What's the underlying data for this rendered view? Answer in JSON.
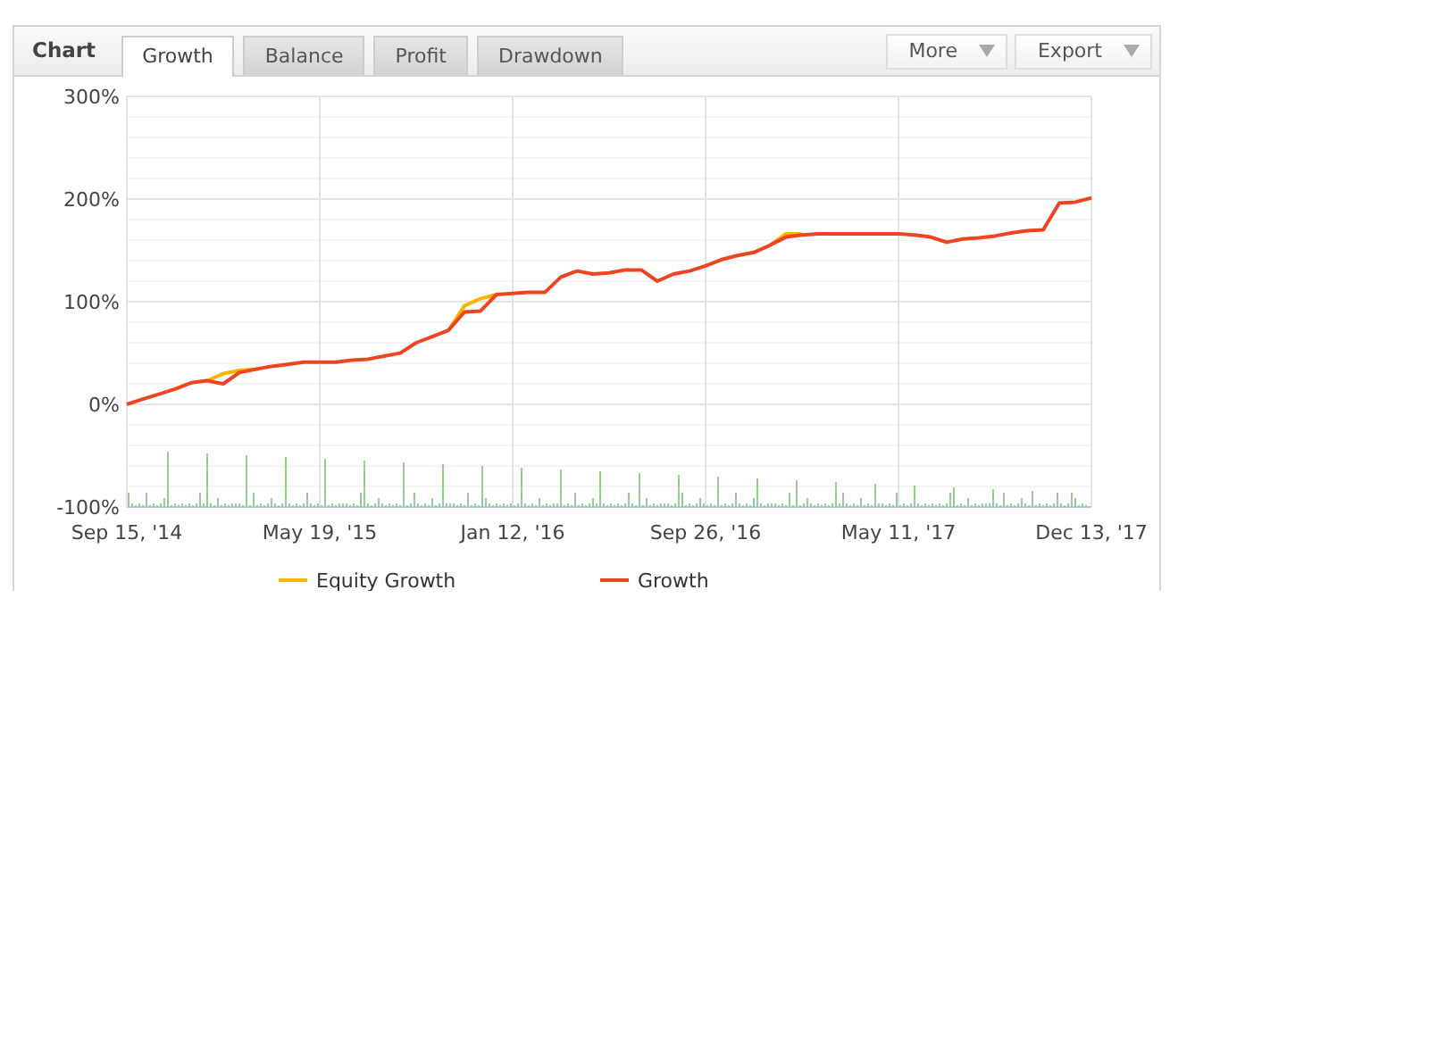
{
  "panel": {
    "title": "Chart",
    "tabs": [
      {
        "label": "Growth",
        "selected": true
      },
      {
        "label": "Balance",
        "selected": false
      },
      {
        "label": "Profit",
        "selected": false
      },
      {
        "label": "Drawdown",
        "selected": false
      }
    ],
    "buttons": [
      "More",
      "Export"
    ],
    "chart_data": {
      "type": "line",
      "categories": [
        "Sep 15, '14",
        null,
        null,
        null,
        null,
        null,
        null,
        null,
        null,
        null,
        null,
        null,
        "May 19, '15",
        null,
        null,
        null,
        null,
        null,
        null,
        null,
        null,
        null,
        null,
        null,
        "Jan 12, '16",
        null,
        null,
        null,
        null,
        null,
        null,
        null,
        null,
        null,
        null,
        null,
        "Sep 26, '16",
        null,
        null,
        null,
        null,
        null,
        null,
        null,
        null,
        null,
        null,
        null,
        "May 11, '17",
        null,
        null,
        null,
        null,
        null,
        null,
        null,
        null,
        null,
        null,
        null,
        "Dec 13, '17"
      ],
      "ylim": [
        -100,
        300
      ],
      "grid": true,
      "legend": true,
      "yticks": [
        {
          "value": -100,
          "label": "-100%"
        },
        {
          "value": 0,
          "label": "0%"
        },
        {
          "value": 100,
          "label": "100%"
        },
        {
          "value": 200,
          "label": "200%"
        },
        {
          "value": 300,
          "label": "300%"
        }
      ],
      "series": [
        {
          "name": "Equity Growth",
          "color": "#f7b500",
          "values": [
            null,
            null,
            null,
            null,
            null,
            23,
            30,
            33,
            34,
            null,
            null,
            null,
            null,
            null,
            null,
            null,
            null,
            null,
            null,
            null,
            72,
            96,
            103,
            107,
            null,
            null,
            null,
            null,
            null,
            null,
            null,
            null,
            null,
            null,
            null,
            null,
            null,
            null,
            null,
            null,
            155,
            166,
            166,
            null,
            null,
            null,
            null,
            null,
            null,
            null,
            null,
            null,
            null,
            null,
            null,
            null,
            null,
            null,
            null,
            null,
            null
          ]
        },
        {
          "name": "Growth",
          "color": "#ee4422",
          "values": [
            0,
            5,
            10,
            15,
            21,
            23,
            20,
            31,
            34,
            37,
            39,
            41,
            41,
            41,
            43,
            44,
            47,
            50,
            60,
            66,
            72,
            90,
            91,
            107,
            108,
            109,
            109,
            124,
            130,
            127,
            128,
            131,
            131,
            120,
            127,
            130,
            135,
            141,
            145,
            148,
            155,
            163,
            165,
            166,
            166,
            166,
            166,
            166,
            166,
            165,
            163,
            158,
            161,
            162,
            164,
            167,
            169,
            170,
            196,
            197,
            201
          ]
        }
      ]
    }
  }
}
